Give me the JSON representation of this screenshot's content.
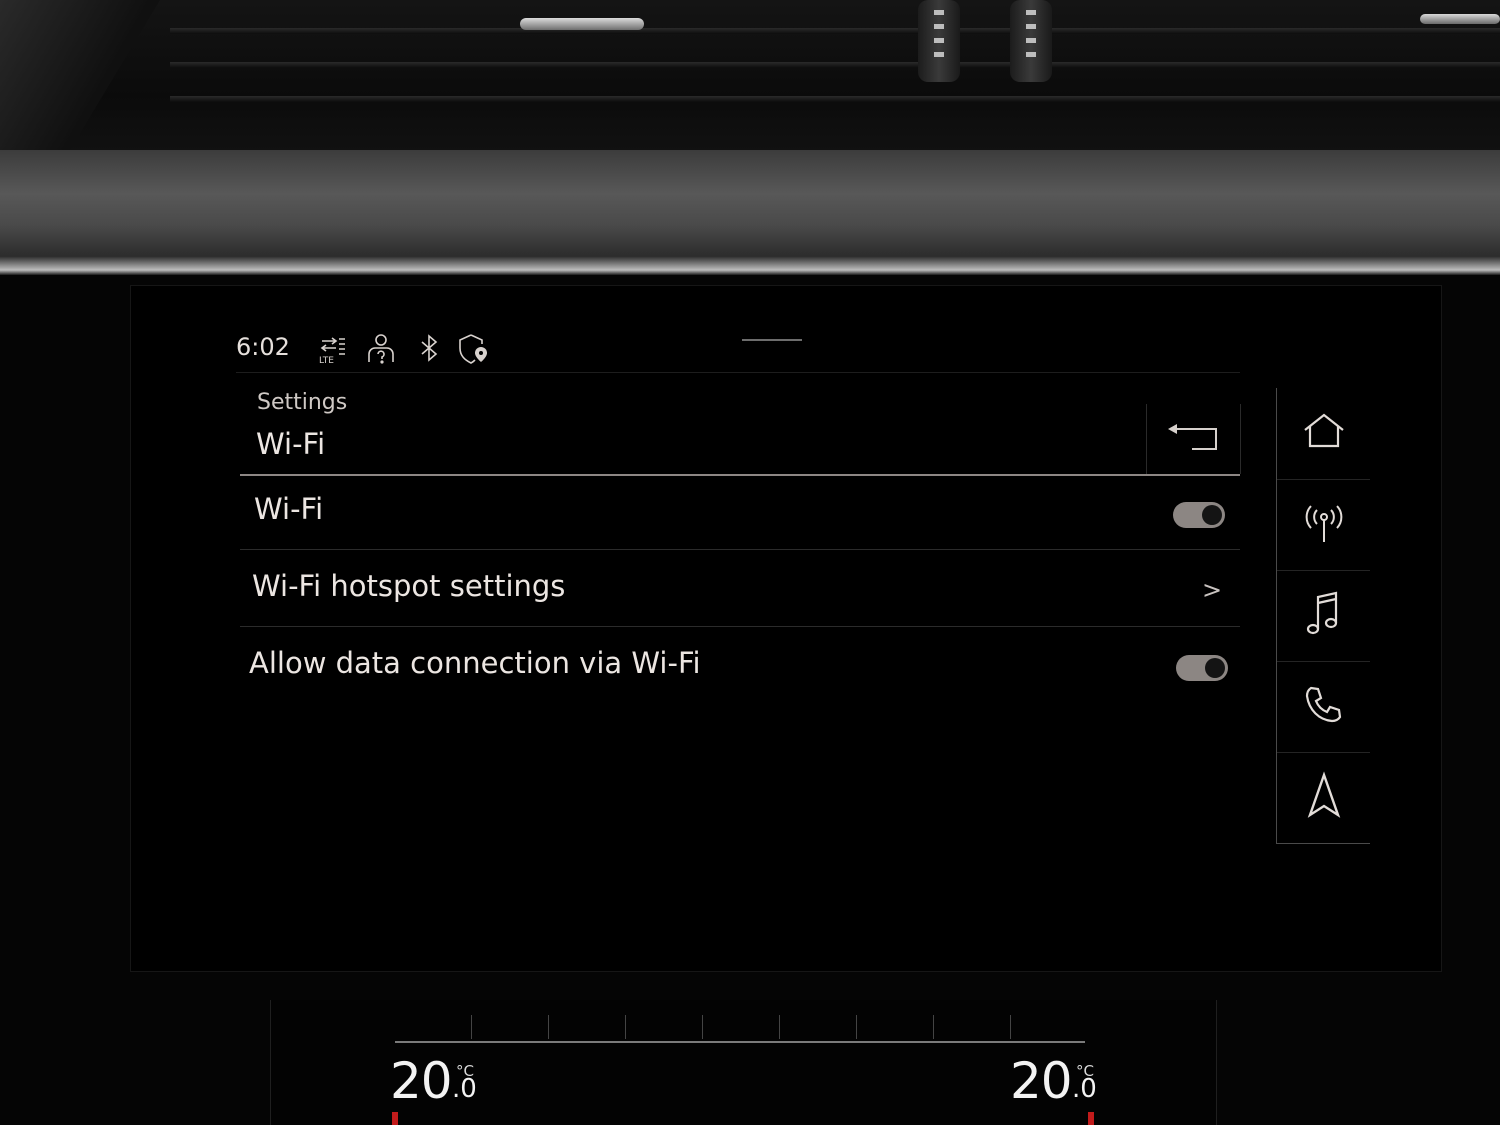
{
  "status_bar": {
    "time": "6:02",
    "icons": [
      "lte-data-icon",
      "user-profile-icon",
      "bluetooth-icon",
      "shield-location-icon"
    ]
  },
  "header": {
    "breadcrumb": "Settings",
    "title": "Wi-Fi",
    "back_icon": "back-arrow-icon"
  },
  "settings": {
    "items": [
      {
        "label": "Wi-Fi",
        "control": "toggle",
        "enabled": true
      },
      {
        "label": "Wi-Fi hotspot settings",
        "control": "chevron",
        "chevron": ">"
      },
      {
        "label": "Allow data connection via Wi-Fi",
        "control": "toggle",
        "enabled": true
      }
    ]
  },
  "side_rail": {
    "items": [
      "home-icon",
      "radio-icon",
      "music-icon",
      "phone-icon",
      "navigation-icon"
    ]
  },
  "climate": {
    "left": {
      "temp": "20",
      "decimal": ".0",
      "unit": "°C"
    },
    "right": {
      "temp": "20",
      "decimal": ".0",
      "unit": "°C"
    }
  },
  "colors": {
    "text": "#ece6e2",
    "toggle_on": "#8c8683",
    "background": "#000000"
  }
}
